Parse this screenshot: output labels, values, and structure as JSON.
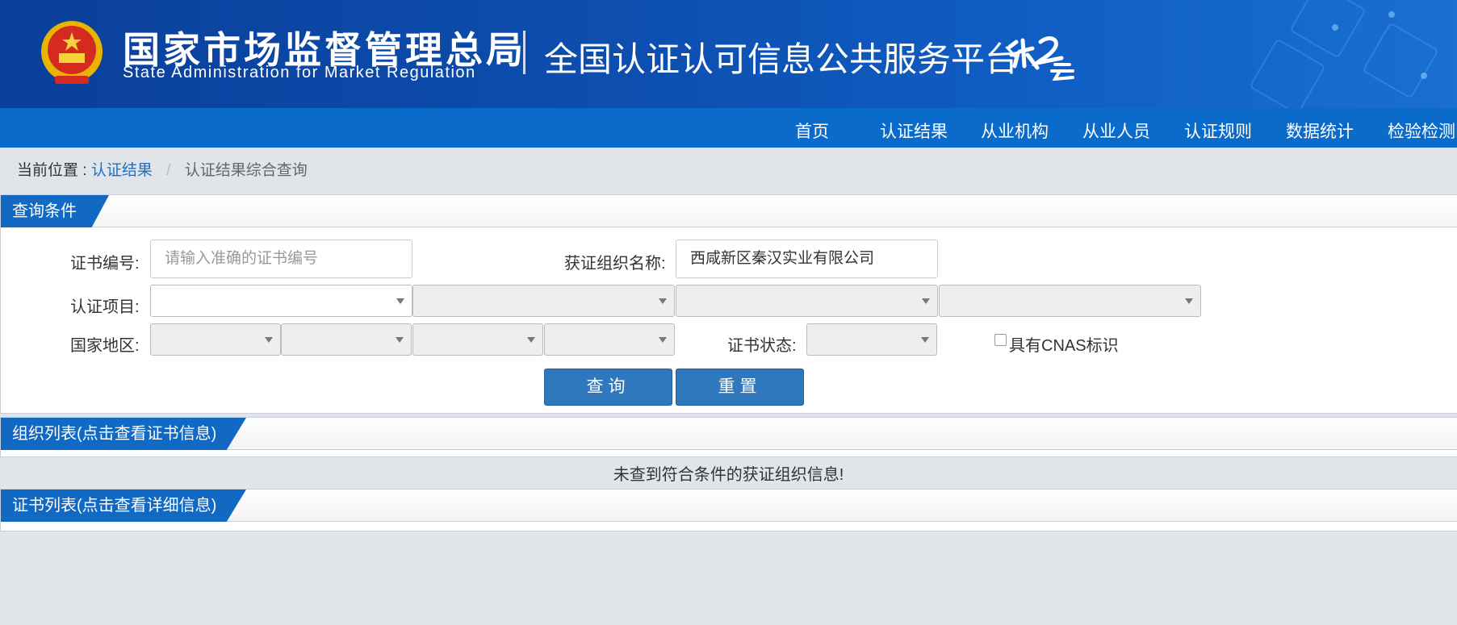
{
  "header": {
    "agency_cn": "国家市场监督管理总局",
    "agency_en": "State Administration  for  Market Regulation",
    "platform_title": "全国认证认可信息公共服务平台",
    "brand_color": "#0d4fb0"
  },
  "nav": {
    "items": [
      "首页",
      "认证结果",
      "从业机构",
      "从业人员",
      "认证规则",
      "数据统计",
      "检验检测"
    ]
  },
  "breadcrumb": {
    "prefix": "当前位置 :",
    "link": "认证结果",
    "separator": "/",
    "current": "认证结果综合查询"
  },
  "query_panel": {
    "title": "查询条件",
    "cert_no_label": "证书编号:",
    "cert_no_placeholder": "请输入准确的证书编号",
    "org_name_label": "获证组织名称:",
    "org_name_value": "西咸新区秦汉实业有限公司",
    "project_label": "认证项目:",
    "region_label": "国家地区:",
    "status_label": "证书状态:",
    "cnas_label": "具有CNAS标识",
    "search_button": "查询",
    "reset_button": "重置"
  },
  "org_panel": {
    "title": "组织列表(点击查看证书信息)",
    "empty_message": "未查到符合条件的获证组织信息!"
  },
  "cert_panel": {
    "title": "证书列表(点击查看详细信息)"
  }
}
